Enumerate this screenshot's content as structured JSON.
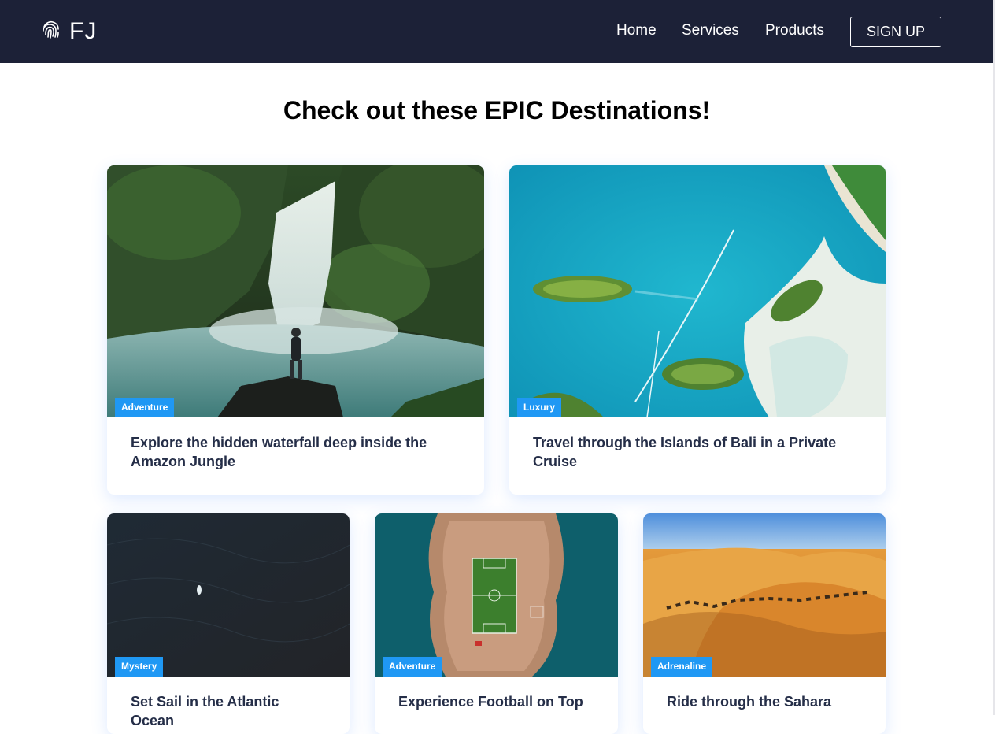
{
  "nav": {
    "logo_text": "FJ",
    "logo_icon": "fingerprint-icon",
    "links": [
      "Home",
      "Services",
      "Products"
    ],
    "signup_label": "SIGN UP"
  },
  "heading": "Check out these EPIC Destinations!",
  "cards": [
    {
      "label": "Adventure",
      "text": "Explore the hidden waterfall deep inside the Amazon Jungle",
      "image": "waterfall-image"
    },
    {
      "label": "Luxury",
      "text": "Travel through the Islands of Bali in a Private Cruise",
      "image": "islands-image"
    },
    {
      "label": "Mystery",
      "text": "Set Sail in the Atlantic Ocean",
      "image": "ocean-image"
    },
    {
      "label": "Adventure",
      "text": "Experience Football on Top",
      "image": "football-island-image"
    },
    {
      "label": "Adrenaline",
      "text": "Ride through the Sahara",
      "image": "sahara-image"
    }
  ],
  "colors": {
    "nav_bg": "#1c2137",
    "badge": "#1f98f4",
    "card_text": "#252e48"
  }
}
